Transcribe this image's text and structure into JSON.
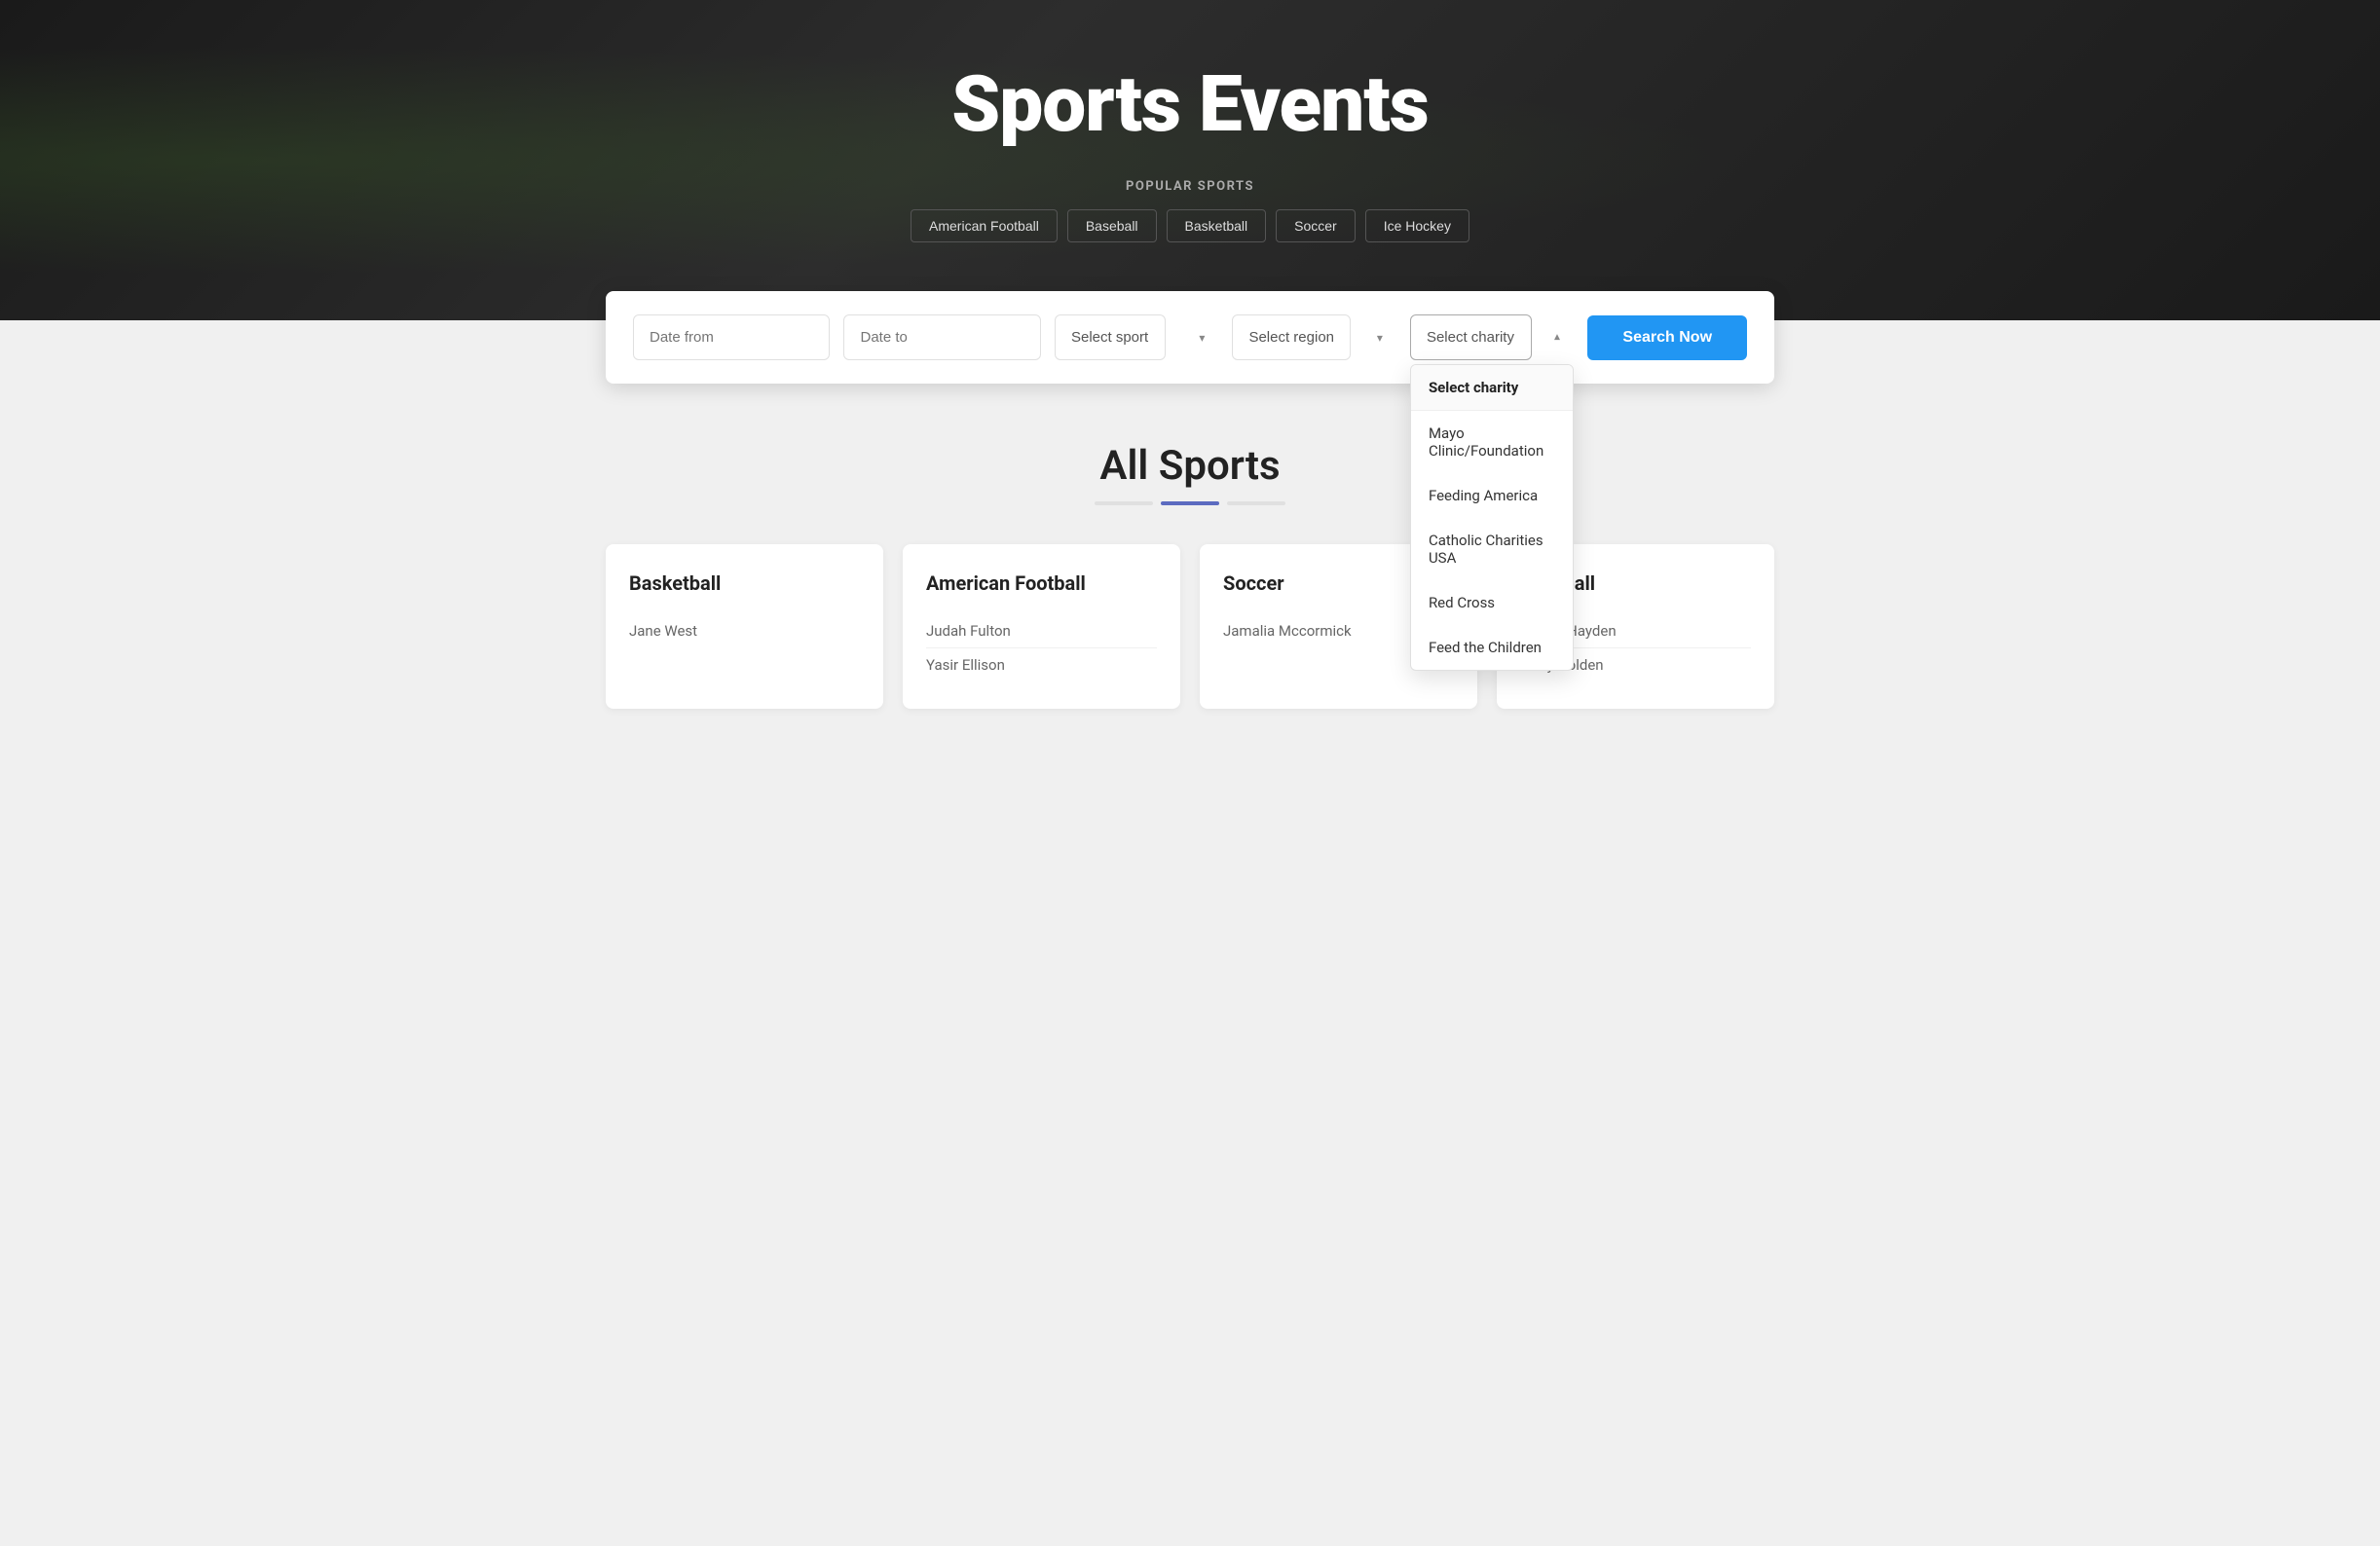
{
  "hero": {
    "title": "Sports Events",
    "popular_sports_label": "POPULAR SPORTS",
    "sports_tags": [
      {
        "label": "American Football",
        "id": "american-football"
      },
      {
        "label": "Baseball",
        "id": "baseball"
      },
      {
        "label": "Basketball",
        "id": "basketball"
      },
      {
        "label": "Soccer",
        "id": "soccer"
      },
      {
        "label": "Ice Hockey",
        "id": "ice-hockey"
      }
    ]
  },
  "search_bar": {
    "date_from_placeholder": "Date from",
    "date_to_placeholder": "Date to",
    "select_sport_placeholder": "Select sport",
    "select_region_placeholder": "Select region",
    "select_charity_placeholder": "Select charity",
    "search_button_label": "Search Now"
  },
  "charity_dropdown": {
    "header": "Select charity",
    "items": [
      "Mayo Clinic/Foundation",
      "Feeding America",
      "Catholic Charities USA",
      "Red Cross",
      "Feed the Children"
    ]
  },
  "section": {
    "title": "All Sports"
  },
  "cards": [
    {
      "sport": "Basketball",
      "people": [
        "Jane West"
      ]
    },
    {
      "sport": "American Football",
      "people": [
        "Judah Fulton",
        "Yasir Ellison"
      ]
    },
    {
      "sport": "Soccer",
      "people": [
        "Jamalia Mccormick"
      ]
    },
    {
      "sport": "Baseball",
      "people": [
        "Hayley Hayden",
        "Perry Golden"
      ]
    }
  ]
}
